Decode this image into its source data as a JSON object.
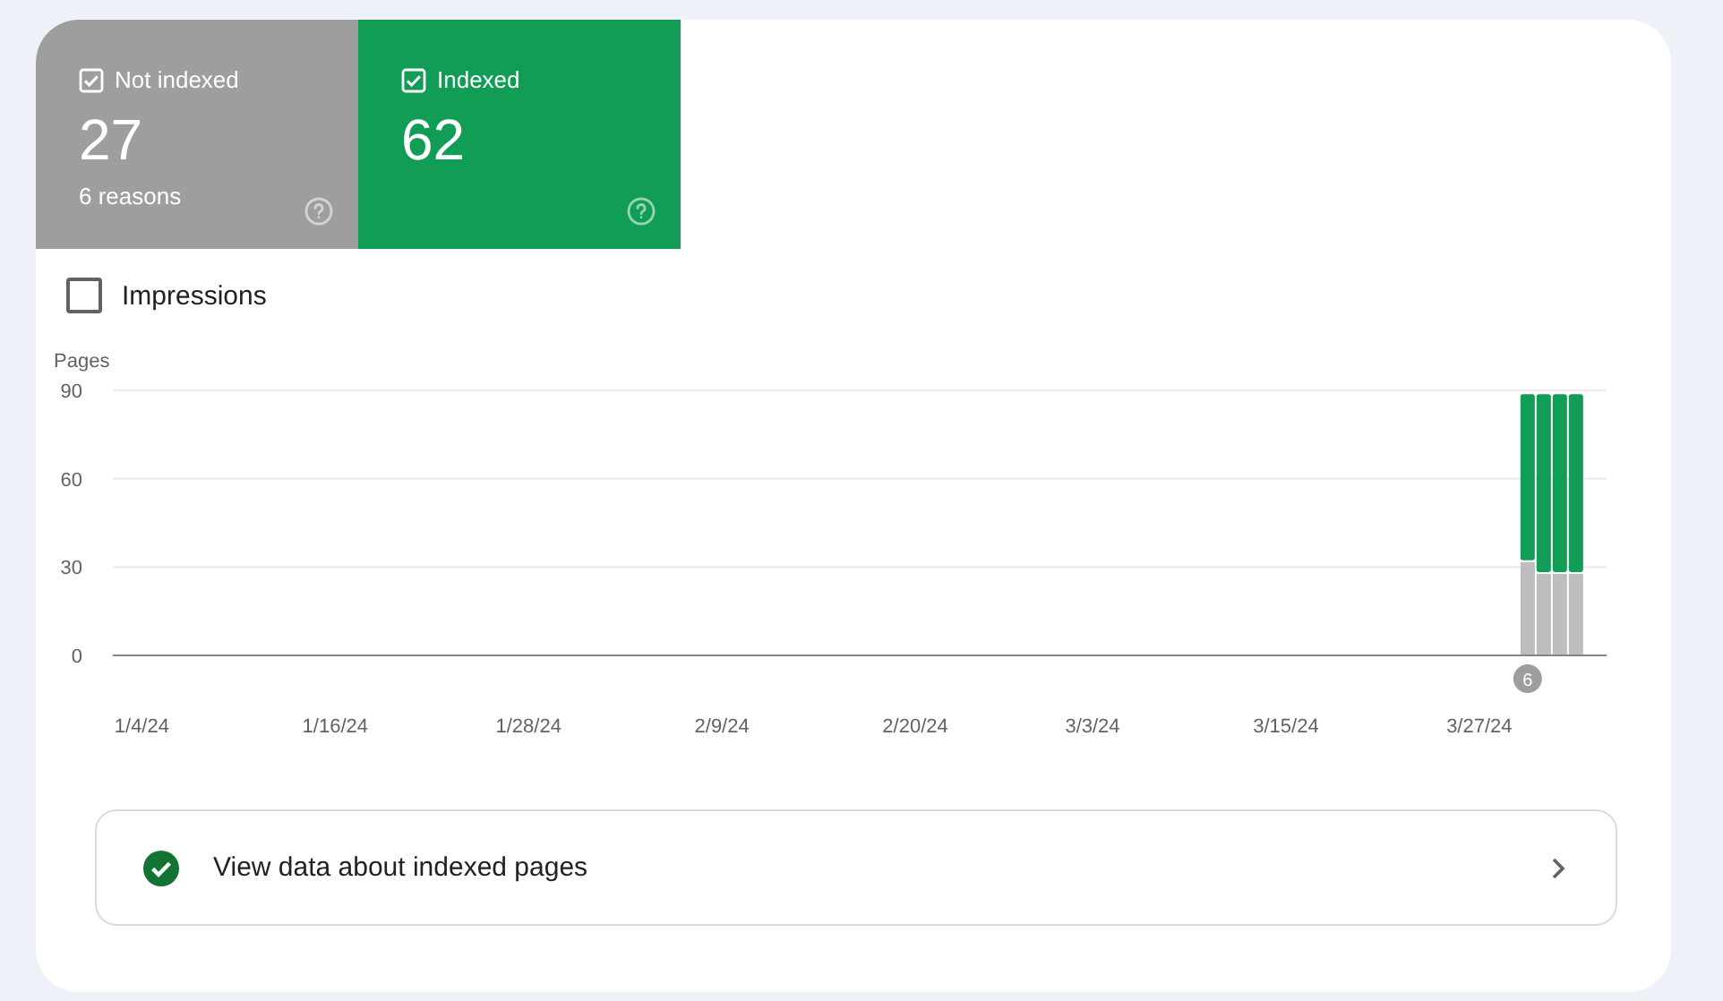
{
  "summary_cards": [
    {
      "label": "Not indexed",
      "value": "27",
      "subtitle": "6 reasons",
      "checked": true,
      "color": "#9e9e9e"
    },
    {
      "label": "Indexed",
      "value": "62",
      "checked": true,
      "color": "#129d57"
    }
  ],
  "impressions": {
    "label": "Impressions",
    "checked": false
  },
  "chart": {
    "chart_data": {
      "type": "bar",
      "stacked": true,
      "ylabel": "Pages",
      "categories": [
        "1/4/24",
        null,
        null,
        null,
        null,
        null,
        null,
        null,
        null,
        null,
        null,
        null,
        "1/16/24",
        null,
        null,
        null,
        null,
        null,
        null,
        null,
        null,
        null,
        null,
        null,
        "1/28/24",
        null,
        null,
        null,
        null,
        null,
        null,
        null,
        null,
        null,
        null,
        null,
        "2/9/24",
        null,
        null,
        null,
        null,
        null,
        null,
        null,
        null,
        null,
        null,
        null,
        "2/20/24",
        null,
        null,
        null,
        null,
        null,
        null,
        null,
        null,
        null,
        null,
        "3/3/24",
        null,
        null,
        null,
        null,
        null,
        null,
        null,
        null,
        null,
        null,
        null,
        "3/15/24",
        null,
        null,
        null,
        null,
        null,
        null,
        null,
        null,
        null,
        null,
        null,
        "3/27/24",
        null,
        null,
        null,
        null,
        null,
        null
      ],
      "series": [
        {
          "color": "#bdbdbd",
          "values": [
            null,
            null,
            null,
            null,
            null,
            null,
            null,
            null,
            null,
            null,
            null,
            null,
            null,
            null,
            null,
            null,
            null,
            null,
            null,
            null,
            null,
            null,
            null,
            null,
            null,
            null,
            null,
            null,
            null,
            null,
            null,
            null,
            null,
            null,
            null,
            null,
            null,
            null,
            null,
            null,
            null,
            null,
            null,
            null,
            null,
            null,
            null,
            null,
            null,
            null,
            null,
            null,
            null,
            null,
            null,
            null,
            null,
            null,
            null,
            null,
            null,
            null,
            null,
            null,
            null,
            null,
            null,
            null,
            null,
            null,
            null,
            null,
            null,
            null,
            null,
            null,
            null,
            null,
            null,
            null,
            null,
            null,
            null,
            null,
            null,
            null,
            32,
            28,
            28,
            28
          ]
        },
        {
          "color": "#129d57",
          "values": [
            null,
            null,
            null,
            null,
            null,
            null,
            null,
            null,
            null,
            null,
            null,
            null,
            null,
            null,
            null,
            null,
            null,
            null,
            null,
            null,
            null,
            null,
            null,
            null,
            null,
            null,
            null,
            null,
            null,
            null,
            null,
            null,
            null,
            null,
            null,
            null,
            null,
            null,
            null,
            null,
            null,
            null,
            null,
            null,
            null,
            null,
            null,
            null,
            null,
            null,
            null,
            null,
            null,
            null,
            null,
            null,
            null,
            null,
            null,
            null,
            null,
            null,
            null,
            null,
            null,
            null,
            null,
            null,
            null,
            null,
            null,
            null,
            null,
            null,
            null,
            null,
            null,
            null,
            null,
            null,
            null,
            null,
            null,
            null,
            null,
            null,
            57,
            61,
            61,
            61
          ]
        }
      ],
      "ylim": [
        0,
        90
      ],
      "yticks": [
        0,
        30,
        60,
        90
      ]
    },
    "event_badge": {
      "text": "6"
    }
  },
  "link_row": {
    "label": "View data about indexed pages"
  }
}
